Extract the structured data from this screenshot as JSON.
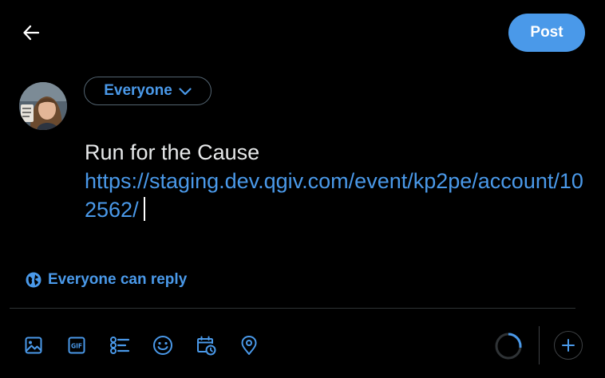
{
  "header": {
    "back_icon": "arrow-left-icon",
    "post_label": "Post"
  },
  "composer": {
    "audience_label": "Everyone",
    "text_line": "Run for the Cause",
    "link_text": "https://staging.dev.qgiv.com/event/kp2pe/account/102562/",
    "reply_setting_label": "Everyone can reply"
  },
  "toolbar": {
    "icons": [
      "image-icon",
      "gif-icon",
      "poll-icon",
      "emoji-icon",
      "schedule-icon",
      "location-icon"
    ],
    "character_progress": 0.27,
    "add_icon": "plus-icon"
  },
  "colors": {
    "accent": "#4a99e9",
    "background": "#000000",
    "text": "#e7e9ea",
    "border": "#536471"
  }
}
